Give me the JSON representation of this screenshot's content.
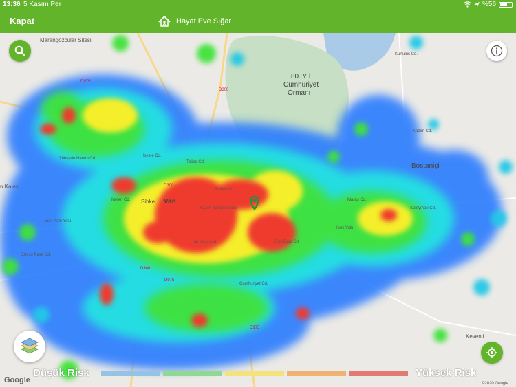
{
  "status": {
    "time": "13:36",
    "date": "5 Kasım Per",
    "battery": "%56"
  },
  "nav": {
    "close_label": "Kapat",
    "title": "Hayat Eve Sığar"
  },
  "map": {
    "places": [
      {
        "text": "Marangozcular Sitesi",
        "cls": ""
      },
      {
        "text": "80. Yıl",
        "cls": "big"
      },
      {
        "text": "Cumhuriyet",
        "cls": "big"
      },
      {
        "text": "Ormanı",
        "cls": "big"
      },
      {
        "text": "Bostaniçi",
        "cls": "big"
      },
      {
        "text": "Van",
        "cls": "big"
      },
      {
        "text": "Sihke",
        "cls": ""
      },
      {
        "text": "n Kalesi",
        "cls": ""
      },
      {
        "text": "Kevenli",
        "cls": ""
      },
      {
        "text": "D975",
        "cls": "road"
      },
      {
        "text": "D300",
        "cls": "road"
      },
      {
        "text": "D300",
        "cls": "road"
      },
      {
        "text": "D300",
        "cls": "road"
      },
      {
        "text": "D975",
        "cls": "road"
      },
      {
        "text": "D975",
        "cls": "road"
      },
      {
        "text": "Eski Kale Yolu",
        "cls": ""
      },
      {
        "text": "Erek Dağı Cd.",
        "cls": ""
      },
      {
        "text": "Kazım Karabekir Blv.",
        "cls": ""
      },
      {
        "text": "Cumhuriyet Cd.",
        "cls": ""
      },
      {
        "text": "İskele Cd.",
        "cls": ""
      },
      {
        "text": "Talipe Cd.",
        "cls": ""
      },
      {
        "text": "Sıhke Cd.",
        "cls": ""
      },
      {
        "text": "Maraş Cd.",
        "cls": ""
      },
      {
        "text": "İpek Yolu",
        "cls": ""
      },
      {
        "text": "Kurtuluş Cd.",
        "cls": ""
      },
      {
        "text": "Kazım Cd.",
        "cls": ""
      },
      {
        "text": "Süleyman Cd.",
        "cls": ""
      },
      {
        "text": "Zübeyde Hanım Cd.",
        "cls": ""
      },
      {
        "text": "Eskisu Paşa Cd.",
        "cls": ""
      },
      {
        "text": "Melen Cd.",
        "cls": ""
      },
      {
        "text": "İki Nisan Cd.",
        "cls": ""
      }
    ]
  },
  "legend": {
    "low_label": "Düşük Risk",
    "high_label": "Yüksek Risk",
    "colors": [
      "#94c3e6",
      "#8fd990",
      "#f4e27a",
      "#f0b272",
      "#e27a72"
    ]
  },
  "attribution": {
    "google": "Google",
    "copyright": "©2020 Google"
  },
  "icons": {
    "search": "search-icon",
    "info": "info-icon",
    "layers": "map-layers-icon",
    "locate": "location-target-icon",
    "pin": "map-pin-icon",
    "logo": "hayat-eve-sigar-logo"
  }
}
